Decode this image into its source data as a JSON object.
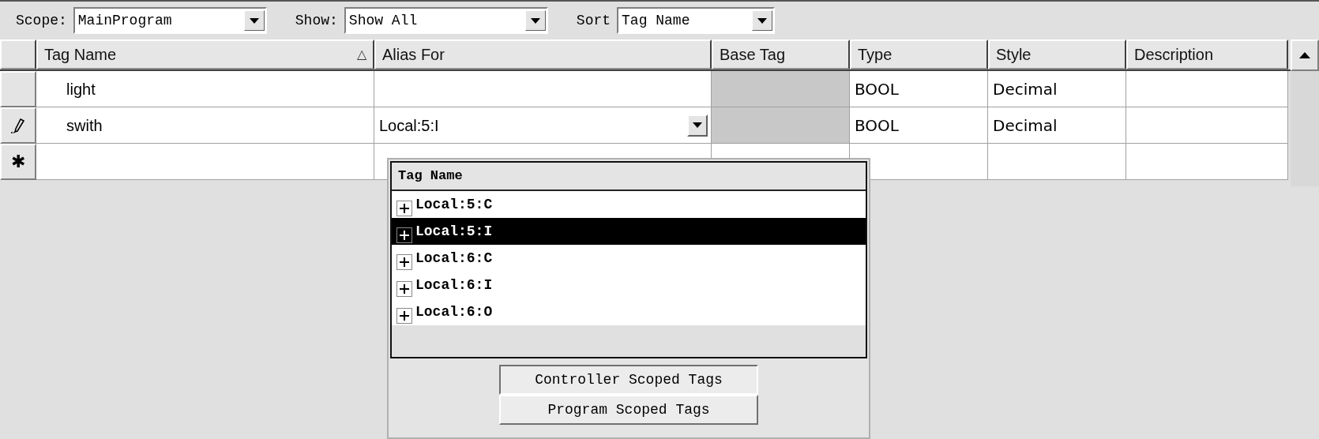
{
  "toolbar": [
    {
      "label": "Scope:",
      "value": "MainProgram"
    },
    {
      "label": "Show:",
      "value": "Show All"
    },
    {
      "label": "Sort",
      "value": "Tag Name"
    }
  ],
  "table": {
    "columns": [
      {
        "label": "Tag Name",
        "sort_glyph": "△"
      },
      {
        "label": "Alias For"
      },
      {
        "label": "Base Tag"
      },
      {
        "label": "Type"
      },
      {
        "label": "Style"
      },
      {
        "label": "Description"
      }
    ],
    "rows": [
      {
        "kind": "none",
        "cells": [
          "light",
          "",
          "",
          "BOOL",
          "Decimal",
          ""
        ]
      },
      {
        "kind": "edit",
        "cells": [
          "swith",
          "Local:5:I",
          "",
          "BOOL",
          "Decimal",
          ""
        ]
      },
      {
        "kind": "new",
        "marker_glyph": "✱",
        "cells": [
          "",
          "",
          "",
          "",
          "",
          ""
        ]
      }
    ]
  },
  "popup": {
    "header": "Tag Name",
    "items": [
      {
        "label": "Local:5:C",
        "selected": false
      },
      {
        "label": "Local:5:I",
        "selected": true
      },
      {
        "label": "Local:6:C",
        "selected": false
      },
      {
        "label": "Local:6:I",
        "selected": false
      },
      {
        "label": "Local:6:O",
        "selected": false
      }
    ],
    "buttons": [
      {
        "label": "Controller Scoped Tags",
        "selected": true
      },
      {
        "label": "Program Scoped Tags",
        "selected": false
      }
    ]
  }
}
